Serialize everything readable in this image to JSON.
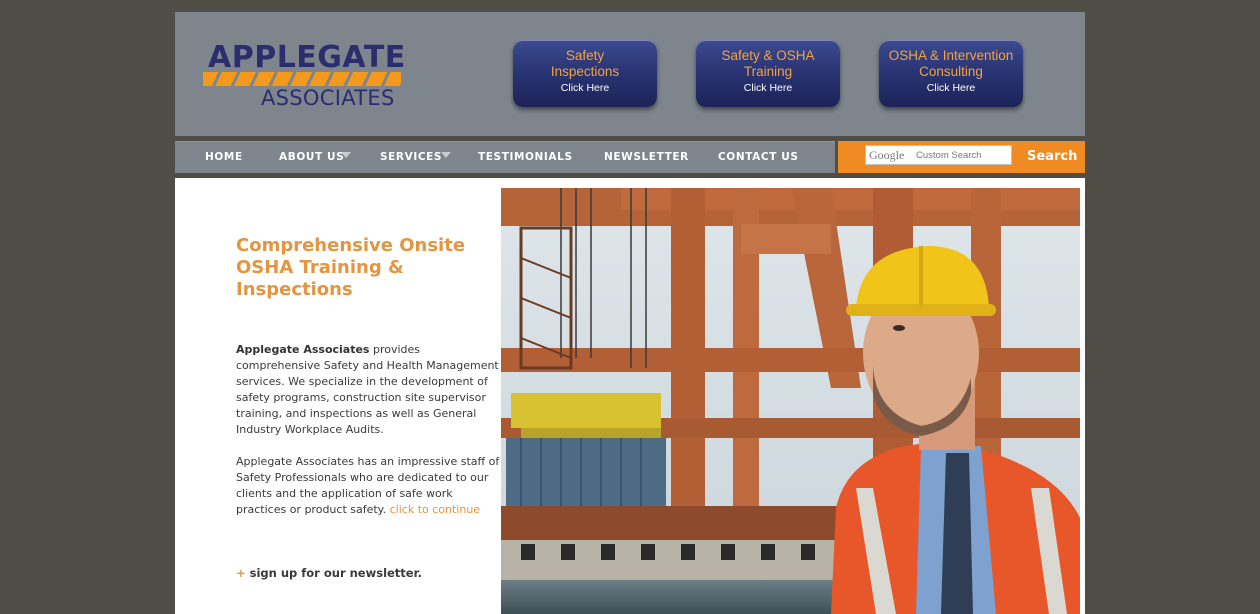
{
  "logo": {
    "line1": "APPLEGATE",
    "line2": "ASSOCIATES"
  },
  "ctas": [
    {
      "title_line1": "Safety",
      "title_line2": "Inspections",
      "action": "Click Here"
    },
    {
      "title_line1": "Safety & OSHA",
      "title_line2": "Training",
      "action": "Click Here"
    },
    {
      "title_line1": "OSHA & Intervention",
      "title_line2": "Consulting",
      "action": "Click Here"
    }
  ],
  "nav": {
    "items": [
      "HOME",
      "ABOUT US",
      "SERVICES",
      "TESTIMONIALS",
      "NEWSLETTER",
      "CONTACT US"
    ]
  },
  "search": {
    "google_label": "Google",
    "placeholder": "Custom Search",
    "button_label": "Search"
  },
  "main": {
    "headline": "Comprehensive Onsite OSHA Training & Inspections",
    "para1_bold": "Applegate Associates",
    "para1_rest": " provides comprehensive Safety and Health Management services. We specialize in the development of safety programs, construction site supervisor training, and inspections as well as General Industry Workplace Audits.",
    "para2": "Applegate Associates has an impressive staff of Safety Professionals who are dedicated to our clients and the application of safe work practices or product safety. ",
    "continue_link": "click to continue",
    "newsletter_plus": "+",
    "newsletter_link": "sign up for our newsletter."
  },
  "colors": {
    "background": "#4e4e46",
    "header": "#7e858d",
    "accent_orange": "#f08a22",
    "headline_orange": "#e3953f",
    "logo_navy": "#2a2d6e",
    "cta_navy": "#2a3575"
  }
}
